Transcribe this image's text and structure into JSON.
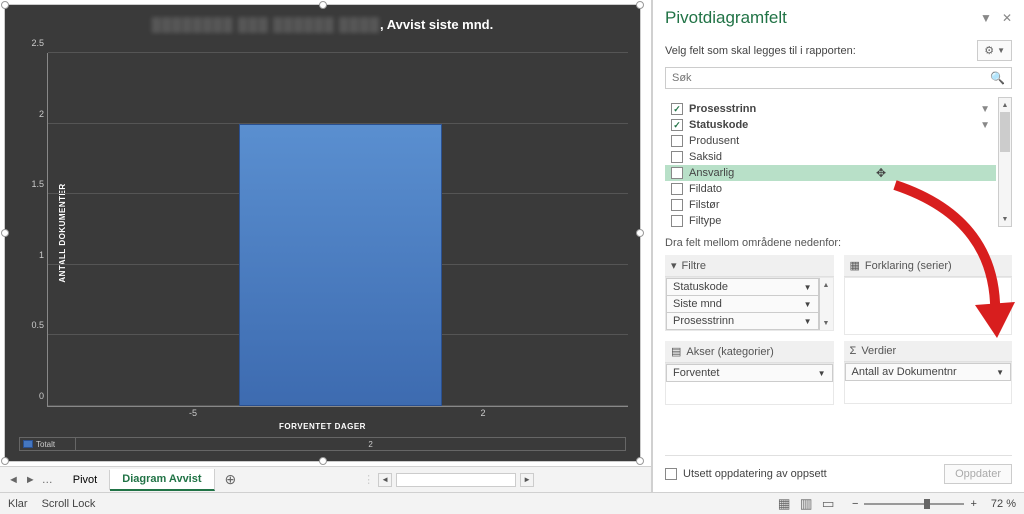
{
  "chart_data": {
    "type": "bar",
    "categories": [
      "-5",
      "2"
    ],
    "values": [
      0,
      2
    ],
    "title": ", Avvist siste mnd.",
    "xlabel": "FORVENTET DAGER",
    "ylabel": "ANTALL DOKUMENTER",
    "ylim": [
      0,
      2.5
    ],
    "yticks": [
      0,
      0.5,
      1,
      1.5,
      2,
      2.5
    ],
    "legend": {
      "label": "Totalt",
      "value": "2"
    }
  },
  "tabs": {
    "items": [
      "Pivot",
      "Diagram Avvist"
    ],
    "ellipsis": "…",
    "active": 1
  },
  "status": {
    "ready": "Klar",
    "scroll": "Scroll Lock",
    "zoom": "72 %",
    "minus": "−",
    "plus": "+"
  },
  "panel": {
    "title": "Pivotdiagramfelt",
    "subtitle": "Velg felt som skal legges til i rapporten:",
    "search_placeholder": "Søk",
    "fields": [
      {
        "label": "Prosesstrinn",
        "checked": true,
        "bold": true,
        "filter": true
      },
      {
        "label": "Statuskode",
        "checked": true,
        "bold": true,
        "filter": true
      },
      {
        "label": "Produsent",
        "checked": false
      },
      {
        "label": "Saksid",
        "checked": false
      },
      {
        "label": "Ansvarlig",
        "checked": false,
        "highlight": true
      },
      {
        "label": "Fildato",
        "checked": false
      },
      {
        "label": "Filstør",
        "checked": false
      },
      {
        "label": "Filtype",
        "checked": false
      }
    ],
    "areas_label": "Dra felt mellom områdene nedenfor:",
    "area_filters": "Filtre",
    "area_legend": "Forklaring (serier)",
    "area_axes": "Akser (kategorier)",
    "area_values": "Verdier",
    "filter_items": [
      "Statuskode",
      "Siste mnd",
      "Prosesstrinn"
    ],
    "axes_items": [
      "Forventet"
    ],
    "values_items": [
      "Antall av Dokumentnr"
    ],
    "defer": "Utsett oppdatering av oppsett",
    "update": "Oppdater"
  }
}
